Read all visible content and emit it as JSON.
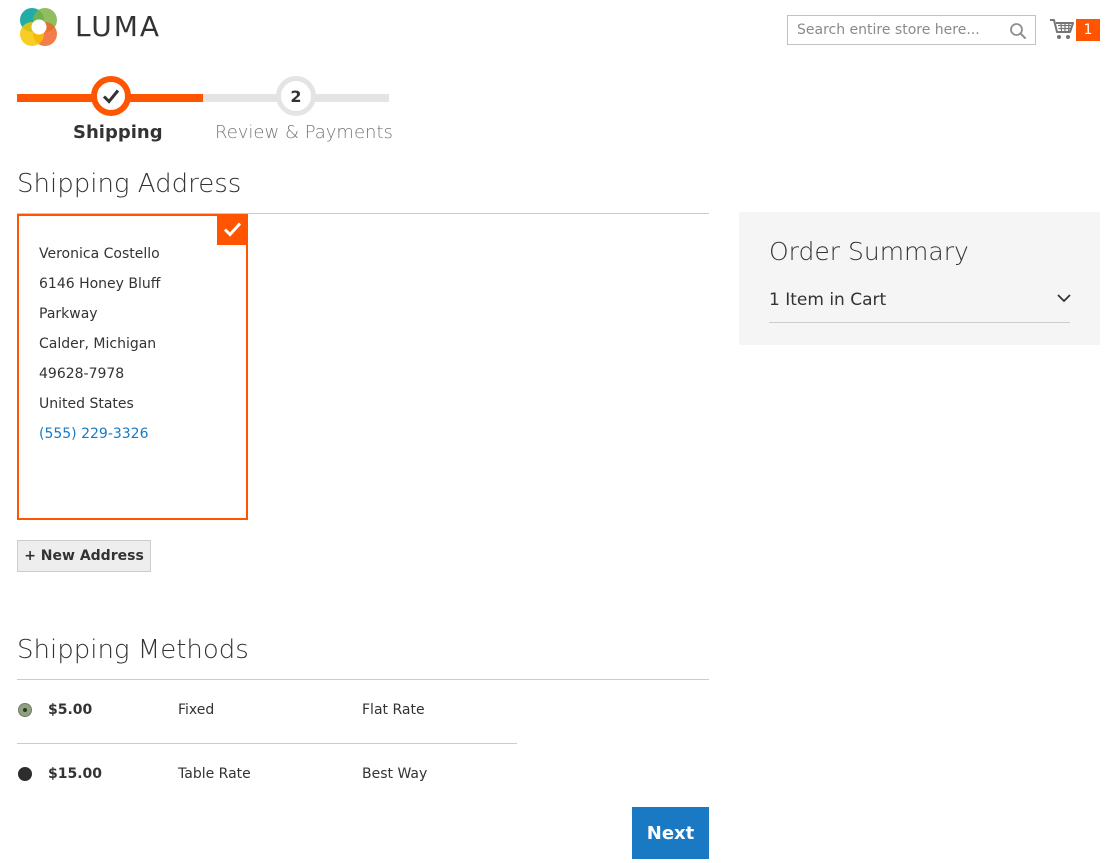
{
  "header": {
    "logo_text": "LUMA",
    "search_placeholder": "Search entire store here...",
    "cart_count": "1"
  },
  "progress": {
    "steps": [
      {
        "label": "Shipping",
        "number": "1",
        "state": "complete"
      },
      {
        "label": "Review & Payments",
        "number": "2",
        "state": "upcoming"
      }
    ]
  },
  "shipping_address": {
    "title": "Shipping Address",
    "selected_address": {
      "name": "Veronica Costello",
      "street_1": "6146 Honey Bluff",
      "street_2": "Parkway",
      "city_region": "Calder, Michigan",
      "postcode": "49628-7978",
      "country": "United States",
      "phone": "(555) 229-3326"
    },
    "new_address_label": "+ New Address"
  },
  "order_summary": {
    "title": "Order Summary",
    "items_label": "1 Item in Cart"
  },
  "shipping_methods": {
    "title": "Shipping Methods",
    "options": [
      {
        "price": "$5.00",
        "method": "Fixed",
        "carrier": "Flat Rate",
        "selected": true
      },
      {
        "price": "$15.00",
        "method": "Table Rate",
        "carrier": "Best Way",
        "selected": false
      }
    ],
    "next_label": "Next"
  },
  "colors": {
    "accent": "#ff5501",
    "link": "#1979c3",
    "primary_button": "#1979c3"
  },
  "icons": [
    "luma-logo-icon",
    "search-icon",
    "cart-icon",
    "checkmark-icon",
    "chevron-down-icon"
  ]
}
